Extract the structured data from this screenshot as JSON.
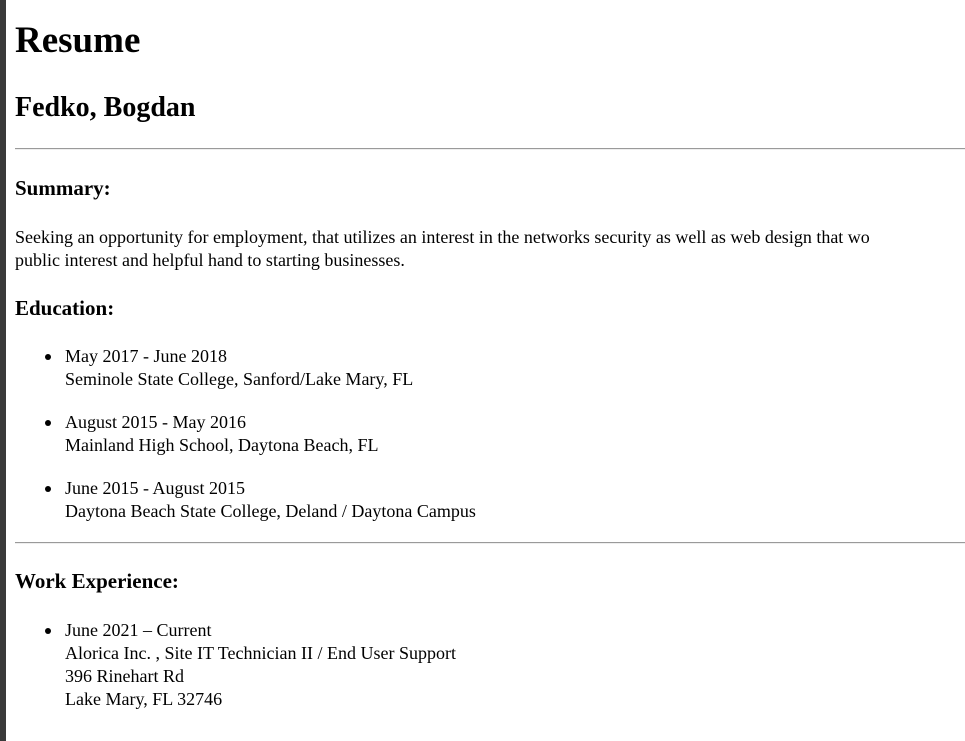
{
  "header": {
    "title": "Resume",
    "name": "Fedko, Bogdan"
  },
  "summary": {
    "heading": "Summary:",
    "line1": "Seeking an opportunity for employment, that utilizes an interest in the networks security as well as web design that wo",
    "line2": "public interest and helpful hand to starting businesses."
  },
  "education": {
    "heading": "Education:",
    "items": [
      {
        "dates": "May 2017 - June 2018",
        "place": "Seminole State College, Sanford/Lake Mary, FL"
      },
      {
        "dates": "August 2015 - May 2016",
        "place": "Mainland High School, Daytona Beach, FL"
      },
      {
        "dates": "June 2015 - August 2015",
        "place": "Daytona Beach State College, Deland / Daytona Campus"
      }
    ]
  },
  "work": {
    "heading": "Work Experience:",
    "items": [
      {
        "dates": "June 2021 – Current",
        "employer": "Alorica Inc. , Site IT Technician II / End User Support",
        "street": "396 Rinehart Rd",
        "city": "Lake Mary, FL 32746"
      }
    ]
  },
  "colors": {
    "left_bar": "#3a3a3a",
    "rule": "#9a9a9a",
    "text": "#000000",
    "background": "#ffffff"
  }
}
